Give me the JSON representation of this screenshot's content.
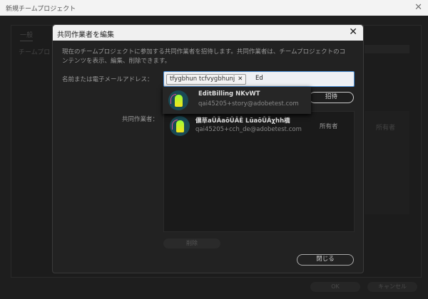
{
  "window": {
    "title": "新規チームプロジェクト"
  },
  "background": {
    "tab": "一般",
    "label": "チームプロ",
    "owner_role": "所有者",
    "ok": "OK",
    "cancel": "キャンセル"
  },
  "dialog": {
    "title": "共同作業者を編集",
    "description": "現在のチームプロジェクトに参加する共同作業者を招待します。共同作業者は、チームプロジェクトのコンテンツを表示、編集、削除できます。",
    "name_label": "名前または電子メールアドレス：",
    "chip": "tfygbhun tcfvygbhunj",
    "typed_value": "Ed",
    "invite": "招待",
    "suggestion": {
      "name": "EditBilling NKvWT",
      "email": "qai45205+story@adobetest.com"
    },
    "collaborators_label": "共同作業者：",
    "collaborators": [
      {
        "name": "儂草aŪÃaōŪÃĒ LūaōŪÃχhh橋",
        "email": "qai45205+cch_de@adobetest.com",
        "role": "所有者"
      }
    ],
    "delete": "削除",
    "close": "閉じる"
  }
}
